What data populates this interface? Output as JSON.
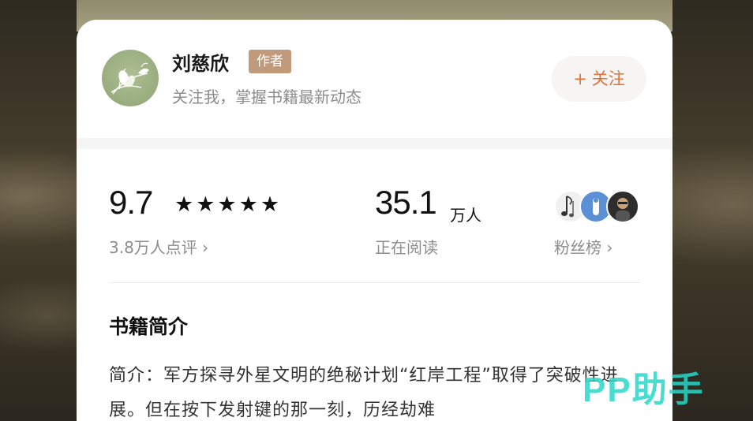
{
  "author": {
    "name": "刘慈欣",
    "badge": "作者",
    "subtitle": "关注我，掌握书籍最新动态",
    "follow_label": "关注",
    "follow_icon": "plus-icon"
  },
  "stats": {
    "score": "9.7",
    "rating_stars": 5,
    "stars_text": "★★★★★",
    "reviews_label": "3.8万人点评 ›",
    "readers_value": "35.1",
    "readers_unit": "万人",
    "readers_label": "正在阅读",
    "fans_label": "粉丝榜 ›"
  },
  "intro": {
    "title": "书籍简介",
    "text": "简介：军方探寻外星文明的绝秘计划“红岸工程”取得了突破性进展。但在按下发射键的那一刻，历经劫难"
  },
  "watermark": "PP助手",
  "colors": {
    "accent": "#e0723c",
    "badge_bg": "#c19a7b",
    "watermark": "#28d7c8"
  }
}
